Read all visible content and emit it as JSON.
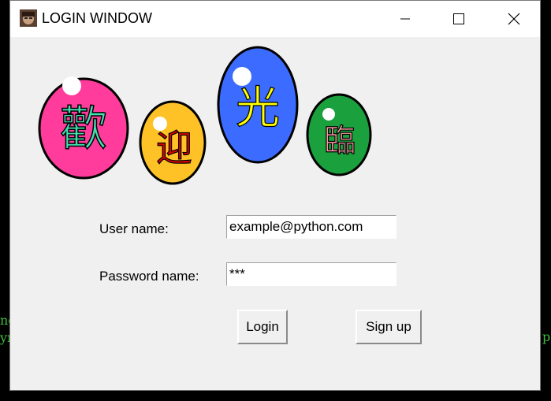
{
  "window": {
    "title": "LOGIN WINDOW",
    "minimize_icon": "minimize-icon",
    "maximize_icon": "maximize-icon",
    "close_icon": "close-icon"
  },
  "banner": {
    "characters": [
      "歡",
      "迎",
      "光",
      "臨"
    ],
    "colors": [
      "#ff3c9c",
      "#ffc226",
      "#3c6cff",
      "#1aa03c"
    ],
    "char_colors": [
      "#40e0b0",
      "#e00000",
      "#ffff00",
      "#ff9aa8"
    ]
  },
  "form": {
    "username_label": "User name:",
    "username_value": "example@python.com",
    "password_label": "Password name:",
    "password_value": "***",
    "login_button": "Login",
    "signup_button": "Sign up"
  },
  "background": {
    "left_text": "ng\nyr",
    "right_text": "p"
  }
}
